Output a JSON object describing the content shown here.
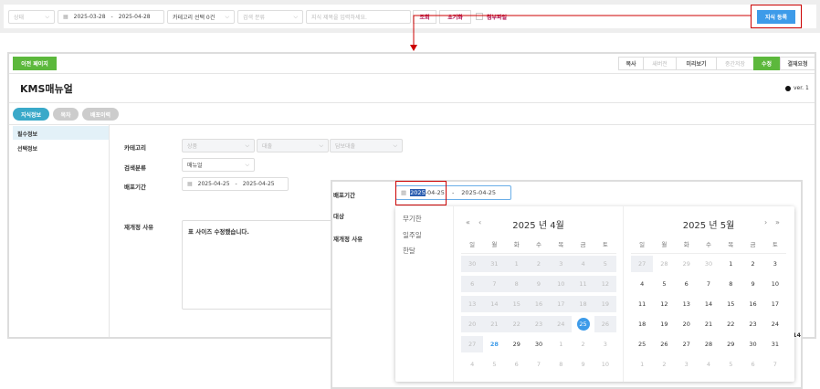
{
  "filter_bar": {
    "status_placeholder": "상태",
    "date_from": "2025-03-28",
    "date_sep": "-",
    "date_to": "2025-04-28",
    "category": "카테고리 선택 0건",
    "search_type_placeholder": "검색 분류",
    "title_placeholder": "지식 제목을 입력하세요.",
    "search_label": "조회",
    "reset_label": "초기화",
    "attachment_label": "첨부파일",
    "register_label": "지식 등록"
  },
  "toolbar": {
    "back_label": "이전 페이지",
    "buttons": [
      "복사",
      "새버전",
      "미리보기",
      "중간저장",
      "수정",
      "결재요청"
    ]
  },
  "header": {
    "title": "KMS매뉴얼",
    "version": "ver. 1"
  },
  "tabs": [
    "지식정보",
    "목차",
    "배포이력"
  ],
  "sidebar": [
    "필수정보",
    "선택정보"
  ],
  "form": {
    "category_label": "카테고리",
    "categories": [
      "상품",
      "대출",
      "담보대출"
    ],
    "search_type_label": "검색분류",
    "search_type": "매뉴얼",
    "period_label": "배포기간",
    "period_from": "2025-04-25",
    "period_sep": "-",
    "period_to": "2025-04-25",
    "reason_label": "재개정 사유",
    "reason": "표 사이즈 수정했습니다.",
    "target_label": "대상"
  },
  "overlay": {
    "period_label": "배포기간",
    "from_selected": "2025",
    "from_rest": "-04-25",
    "sep": "-",
    "to": "2025-04-25",
    "target_label": "대상",
    "reason_label": "재개정 사유",
    "peek_text": "14"
  },
  "datepicker": {
    "presets": [
      "무기한",
      "일주일",
      "한달"
    ],
    "weekdays": [
      "일",
      "월",
      "화",
      "수",
      "목",
      "금",
      "토"
    ],
    "months": [
      {
        "title": "2025 년 4월",
        "weeks": [
          [
            30,
            31,
            1,
            2,
            3,
            4,
            5
          ],
          [
            6,
            7,
            8,
            9,
            10,
            11,
            12
          ],
          [
            13,
            14,
            15,
            16,
            17,
            18,
            19
          ],
          [
            20,
            21,
            22,
            23,
            24,
            25,
            26
          ],
          [
            27,
            28,
            29,
            30,
            1,
            2,
            3
          ],
          [
            4,
            5,
            6,
            7,
            8,
            9,
            10
          ]
        ],
        "selected": 25,
        "today": 28
      },
      {
        "title": "2025 년 5월",
        "weeks": [
          [
            27,
            28,
            29,
            30,
            1,
            2,
            3
          ],
          [
            4,
            5,
            6,
            7,
            8,
            9,
            10
          ],
          [
            11,
            12,
            13,
            14,
            15,
            16,
            17
          ],
          [
            18,
            19,
            20,
            21,
            22,
            23,
            24
          ],
          [
            25,
            26,
            27,
            28,
            29,
            30,
            31
          ],
          [
            1,
            2,
            3,
            4,
            5,
            6,
            7
          ]
        ]
      }
    ]
  },
  "colors": {
    "green": "#5cb83c",
    "blue": "#3d9be9",
    "teal": "#3aa9c9",
    "annotation": "#cc0000"
  }
}
